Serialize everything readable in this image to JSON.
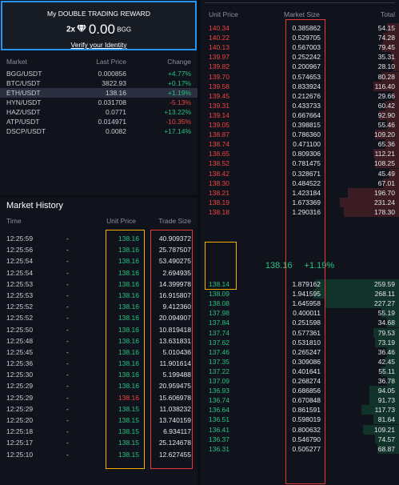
{
  "reward": {
    "title": "My DOUBLE TRADING REWARD",
    "multiplier": "2x",
    "amount": "0.00",
    "unit": "BGG",
    "verify_label": "Verify your Identity"
  },
  "market": {
    "headers": {
      "name": "Market",
      "price": "Last Price",
      "change": "Change"
    },
    "rows": [
      {
        "name": "BGG/USDT",
        "price": "0.000856",
        "change": "+4.77%",
        "dir": "up"
      },
      {
        "name": "BTC/USDT",
        "price": "3822.93",
        "change": "+0.17%",
        "dir": "up"
      },
      {
        "name": "ETH/USDT",
        "price": "138.16",
        "change": "+1.19%",
        "dir": "up"
      },
      {
        "name": "HYN/USDT",
        "price": "0.031708",
        "change": "-5.13%",
        "dir": "down"
      },
      {
        "name": "HAZ/USDT",
        "price": "0.0771",
        "change": "+13.22%",
        "dir": "up"
      },
      {
        "name": "ATP/USDT",
        "price": "0.014971",
        "change": "-10.35%",
        "dir": "down"
      },
      {
        "name": "DSCP/USDT",
        "price": "0.0082",
        "change": "+17.14%",
        "dir": "up"
      }
    ],
    "selected_index": 2
  },
  "history": {
    "title": "Market History",
    "headers": {
      "time": "Time",
      "price": "Unit Price",
      "size": "Trade Size"
    },
    "rows": [
      {
        "time": "12:25:59",
        "dash": "-",
        "price": "138.16",
        "size": "40.909372",
        "dir": "up"
      },
      {
        "time": "12:25:56",
        "dash": "-",
        "price": "138.16",
        "size": "25.787507",
        "dir": "up"
      },
      {
        "time": "12:25:54",
        "dash": "-",
        "price": "138.16",
        "size": "53.490275",
        "dir": "up"
      },
      {
        "time": "12:25:54",
        "dash": "-",
        "price": "138.16",
        "size": "2.694935",
        "dir": "up"
      },
      {
        "time": "12:25:53",
        "dash": "-",
        "price": "138.16",
        "size": "14.399978",
        "dir": "up"
      },
      {
        "time": "12:25:53",
        "dash": "-",
        "price": "138.16",
        "size": "16.915807",
        "dir": "up"
      },
      {
        "time": "12:25:52",
        "dash": "-",
        "price": "138.16",
        "size": "9.412360",
        "dir": "up"
      },
      {
        "time": "12:25:52",
        "dash": "-",
        "price": "138.16",
        "size": "20.094907",
        "dir": "up"
      },
      {
        "time": "12:25:50",
        "dash": "-",
        "price": "138.16",
        "size": "10.819418",
        "dir": "up"
      },
      {
        "time": "12:25:48",
        "dash": "-",
        "price": "138.16",
        "size": "13.631831",
        "dir": "up"
      },
      {
        "time": "12:25:45",
        "dash": "-",
        "price": "138.16",
        "size": "5.010436",
        "dir": "up"
      },
      {
        "time": "12:25:36",
        "dash": "-",
        "price": "138.16",
        "size": "11.901614",
        "dir": "up"
      },
      {
        "time": "12:25:30",
        "dash": "-",
        "price": "138.16",
        "size": "5.199488",
        "dir": "up"
      },
      {
        "time": "12:25:29",
        "dash": "-",
        "price": "138.16",
        "size": "20.959475",
        "dir": "up"
      },
      {
        "time": "12:25:29",
        "dash": "-",
        "price": "138.16",
        "size": "15.606978",
        "dir": "down"
      },
      {
        "time": "12:25:29",
        "dash": "-",
        "price": "138.15",
        "size": "11.038232",
        "dir": "up"
      },
      {
        "time": "12:25:20",
        "dash": "-",
        "price": "138.15",
        "size": "13.740159",
        "dir": "up"
      },
      {
        "time": "12:25:18",
        "dash": "-",
        "price": "138.15",
        "size": "6.934117",
        "dir": "up"
      },
      {
        "time": "12:25:17",
        "dash": "-",
        "price": "138.15",
        "size": "25.124678",
        "dir": "up"
      },
      {
        "time": "12:25:10",
        "dash": "-",
        "price": "138.15",
        "size": "12.627455",
        "dir": "up"
      }
    ]
  },
  "orderbook": {
    "headers": {
      "price": "Unit Price",
      "size": "Market Size",
      "total": "Total"
    },
    "asks": [
      {
        "price": "140.34",
        "size": "0.385862",
        "total": "54.15",
        "depth": 0.06
      },
      {
        "price": "140.22",
        "size": "0.529705",
        "total": "74.28",
        "depth": 0.08
      },
      {
        "price": "140.13",
        "size": "0.567003",
        "total": "79.45",
        "depth": 0.09
      },
      {
        "price": "139.97",
        "size": "0.252242",
        "total": "35.31",
        "depth": 0.04
      },
      {
        "price": "139.82",
        "size": "0.200967",
        "total": "28.10",
        "depth": 0.03
      },
      {
        "price": "139.70",
        "size": "0.574653",
        "total": "80.28",
        "depth": 0.09
      },
      {
        "price": "139.58",
        "size": "0.833924",
        "total": "116.40",
        "depth": 0.13
      },
      {
        "price": "139.45",
        "size": "0.212676",
        "total": "29.66",
        "depth": 0.03
      },
      {
        "price": "139.31",
        "size": "0.433733",
        "total": "60.42",
        "depth": 0.07
      },
      {
        "price": "139.14",
        "size": "0.667664",
        "total": "92.90",
        "depth": 0.1
      },
      {
        "price": "139.05",
        "size": "0.398815",
        "total": "55.46",
        "depth": 0.06
      },
      {
        "price": "138.87",
        "size": "0.786360",
        "total": "109.20",
        "depth": 0.12
      },
      {
        "price": "138.74",
        "size": "0.471100",
        "total": "65.36",
        "depth": 0.07
      },
      {
        "price": "138.65",
        "size": "0.809306",
        "total": "112.21",
        "depth": 0.13
      },
      {
        "price": "138.52",
        "size": "0.781475",
        "total": "108.25",
        "depth": 0.12
      },
      {
        "price": "138.42",
        "size": "0.328671",
        "total": "45.49",
        "depth": 0.05
      },
      {
        "price": "138.30",
        "size": "0.484522",
        "total": "67.01",
        "depth": 0.08
      },
      {
        "price": "138.21",
        "size": "1.423184",
        "total": "196.70",
        "depth": 0.26
      },
      {
        "price": "138.19",
        "size": "1.673369",
        "total": "231.24",
        "depth": 0.3
      },
      {
        "price": "138.18",
        "size": "1.290316",
        "total": "178.30",
        "depth": 0.28
      }
    ],
    "last_price": "138.16",
    "last_change": "+1.19%",
    "bids": [
      {
        "price": "138.14",
        "size": "1.879162",
        "total": "259.59",
        "depth": 0.42
      },
      {
        "price": "138.09",
        "size": "1.941595",
        "total": "268.11",
        "depth": 0.43
      },
      {
        "price": "138.08",
        "size": "1.645958",
        "total": "227.27",
        "depth": 0.37
      },
      {
        "price": "137.98",
        "size": "0.400011",
        "total": "55.19",
        "depth": 0.09
      },
      {
        "price": "137.84",
        "size": "0.251598",
        "total": "34.68",
        "depth": 0.06
      },
      {
        "price": "137.74",
        "size": "0.577361",
        "total": "79.53",
        "depth": 0.13
      },
      {
        "price": "137.62",
        "size": "0.531810",
        "total": "73.19",
        "depth": 0.12
      },
      {
        "price": "137.46",
        "size": "0.265247",
        "total": "36.46",
        "depth": 0.06
      },
      {
        "price": "137.35",
        "size": "0.309086",
        "total": "42.45",
        "depth": 0.07
      },
      {
        "price": "137.22",
        "size": "0.401641",
        "total": "55.11",
        "depth": 0.09
      },
      {
        "price": "137.09",
        "size": "0.268274",
        "total": "36.78",
        "depth": 0.06
      },
      {
        "price": "136.93",
        "size": "0.686856",
        "total": "94.05",
        "depth": 0.15
      },
      {
        "price": "136.74",
        "size": "0.670848",
        "total": "91.73",
        "depth": 0.15
      },
      {
        "price": "136.64",
        "size": "0.861591",
        "total": "117.73",
        "depth": 0.19
      },
      {
        "price": "136.51",
        "size": "0.598019",
        "total": "81.64",
        "depth": 0.13
      },
      {
        "price": "136.41",
        "size": "0.800632",
        "total": "109.21",
        "depth": 0.18
      },
      {
        "price": "136.37",
        "size": "0.546790",
        "total": "74.57",
        "depth": 0.12
      },
      {
        "price": "136.31",
        "size": "0.505277",
        "total": "68.87",
        "depth": 0.11
      }
    ]
  },
  "colors": {
    "up": "#26c281",
    "down": "#f0433f",
    "ask_bar": "#3a1c22",
    "bid_bar": "#123329",
    "highlight_yellow": "#f5b000",
    "highlight_red": "#e53935",
    "accent_blue": "#2196f3"
  }
}
